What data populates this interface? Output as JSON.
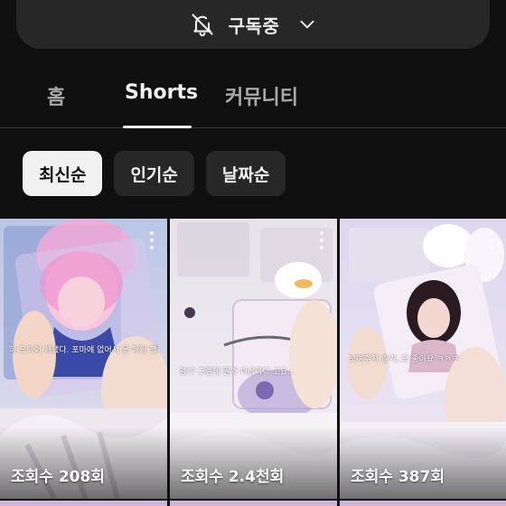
{
  "subscribe": {
    "label": "구독중",
    "icon": "bell-off-icon",
    "dropdown_icon": "chevron-down-icon"
  },
  "tabs": [
    {
      "label": "홈",
      "active": false
    },
    {
      "label": "Shorts",
      "active": true
    },
    {
      "label": "커뮤니티",
      "active": false
    }
  ],
  "filters": [
    {
      "label": "최신순",
      "selected": true
    },
    {
      "label": "인기순",
      "selected": false
    },
    {
      "label": "날짜순",
      "selected": false
    }
  ],
  "shorts": [
    {
      "views": "조회수 208회",
      "caption": "하 드디어 해냈다. 포마에 없어서 못 매입 했는데"
    },
    {
      "views": "조회수 2.4천회",
      "caption": "엄?? 그런데 뭔가 이상하다 고요.."
    },
    {
      "views": "조회수 387회",
      "caption": "보여주지 않기..오 좋아요 ㅋㅋㅋ"
    }
  ],
  "colors": {
    "background": "#0f0f0f",
    "chip": "#272727",
    "chip_selected": "#f1f1f1",
    "text": "#f1f1f1",
    "muted": "#aaaaaa"
  }
}
